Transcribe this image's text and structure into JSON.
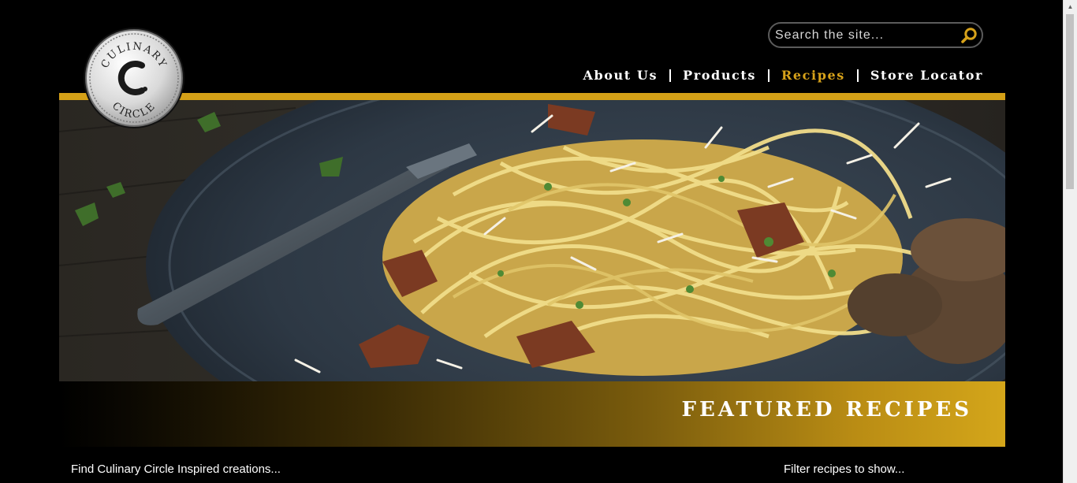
{
  "header": {
    "search_placeholder": "Search the site...",
    "nav": [
      {
        "label": "About Us",
        "active": false
      },
      {
        "label": "Products",
        "active": false
      },
      {
        "label": "Recipes",
        "active": true
      },
      {
        "label": "Store Locator",
        "active": false
      }
    ]
  },
  "logo": {
    "text": "CULINARY CIRCLE",
    "icon": "culinary-circle-logo"
  },
  "hero": {
    "icon": "spaghetti-photo"
  },
  "banner": {
    "title": "FEATURED RECIPES"
  },
  "content": {
    "intro_text": "Find Culinary Circle Inspired creations...",
    "filter_label": "Filter recipes to show..."
  },
  "colors": {
    "accent": "#d4a017",
    "nav_active": "#d7a21a",
    "background": "#000000"
  }
}
